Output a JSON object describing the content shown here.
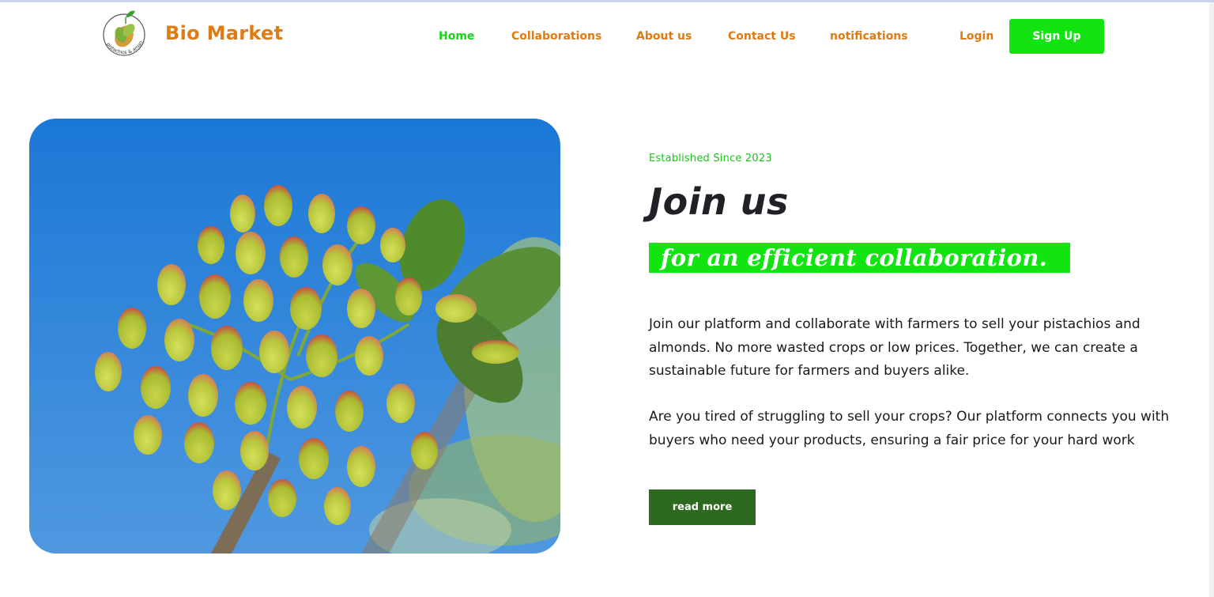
{
  "brand": {
    "name": "Bio Market",
    "logo_ring_text": "pistachios & amandes bio",
    "color": "#e07b12"
  },
  "nav": {
    "items": [
      {
        "label": "Home",
        "active": true
      },
      {
        "label": "Collaborations",
        "active": false
      },
      {
        "label": "About us",
        "active": false
      },
      {
        "label": "Contact Us",
        "active": false
      },
      {
        "label": "notifications",
        "active": false
      },
      {
        "label": "Login",
        "active": false
      }
    ],
    "signup_label": "Sign Up"
  },
  "hero": {
    "image_icon": "pistachio-photo",
    "tagline": "Established Since 2023",
    "title": "Join us",
    "highlight": "for an efficient collaboration.",
    "paragraph1": "Join our platform and collaborate with farmers to sell your pistachios and almonds. No more wasted crops or low prices. Together, we can create a sustainable future for farmers and buyers alike.",
    "paragraph2": "Are you tired of struggling to sell your crops? Our platform connects you with buyers who need your products, ensuring a fair price for your hard work",
    "read_more_label": "read more"
  },
  "colors": {
    "accent_green": "#12e412",
    "nav_orange": "#df7a12",
    "button_dark_green": "#2e6a1d"
  }
}
